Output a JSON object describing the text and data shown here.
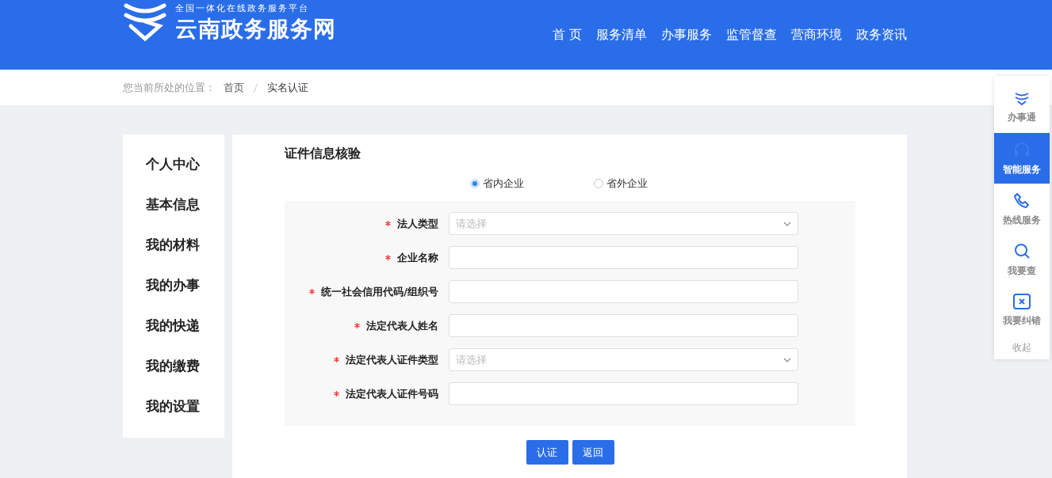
{
  "header": {
    "slogan": "全国一体化在线政务服务平台",
    "site_name": "云南政务服务网",
    "nav": [
      {
        "label": "首 页",
        "selected": false
      },
      {
        "label": "服务清单",
        "selected": false
      },
      {
        "label": "办事服务",
        "selected": false
      },
      {
        "label": "监管督查",
        "selected": false
      },
      {
        "label": "营商环境",
        "selected": false
      },
      {
        "label": "政务资讯",
        "selected": false
      }
    ]
  },
  "breadcrumb": {
    "prefix": "您当前所处的位置：",
    "items": [
      "首页",
      "实名认证"
    ]
  },
  "sidebar": {
    "items": [
      {
        "label": "个人中心"
      },
      {
        "label": "基本信息"
      },
      {
        "label": "我的材料"
      },
      {
        "label": "我的办事"
      },
      {
        "label": "我的快递"
      },
      {
        "label": "我的缴费"
      },
      {
        "label": "我的设置"
      }
    ]
  },
  "form": {
    "title": "证件信息核验",
    "radios": [
      {
        "label": "省内企业",
        "selected": true
      },
      {
        "label": "省外企业",
        "selected": false
      }
    ],
    "fields": [
      {
        "label": "法人类型",
        "kind": "select",
        "required": true,
        "placeholder": "请选择"
      },
      {
        "label": "企业名称",
        "kind": "text",
        "required": true
      },
      {
        "label": "统一社会信用代码/组织号",
        "kind": "text",
        "required": true
      },
      {
        "label": "法定代表人姓名",
        "kind": "text",
        "required": true
      },
      {
        "label": "法定代表人证件类型",
        "kind": "select",
        "required": true,
        "placeholder": "请选择"
      },
      {
        "label": "法定代表人证件号码",
        "kind": "text",
        "required": true
      }
    ],
    "buttons": [
      "认证",
      "返回"
    ]
  },
  "float_panel": {
    "items": [
      {
        "label": "办事通",
        "kind": "logo",
        "selected": false
      },
      {
        "label": "智能服务",
        "kind": "headset",
        "selected": true
      },
      {
        "label": "热线服务",
        "kind": "phone",
        "selected": false
      },
      {
        "label": "我要查",
        "kind": "search",
        "selected": false
      },
      {
        "label": "我要纠错",
        "kind": "close",
        "selected": false
      }
    ],
    "collapse": "收起"
  }
}
